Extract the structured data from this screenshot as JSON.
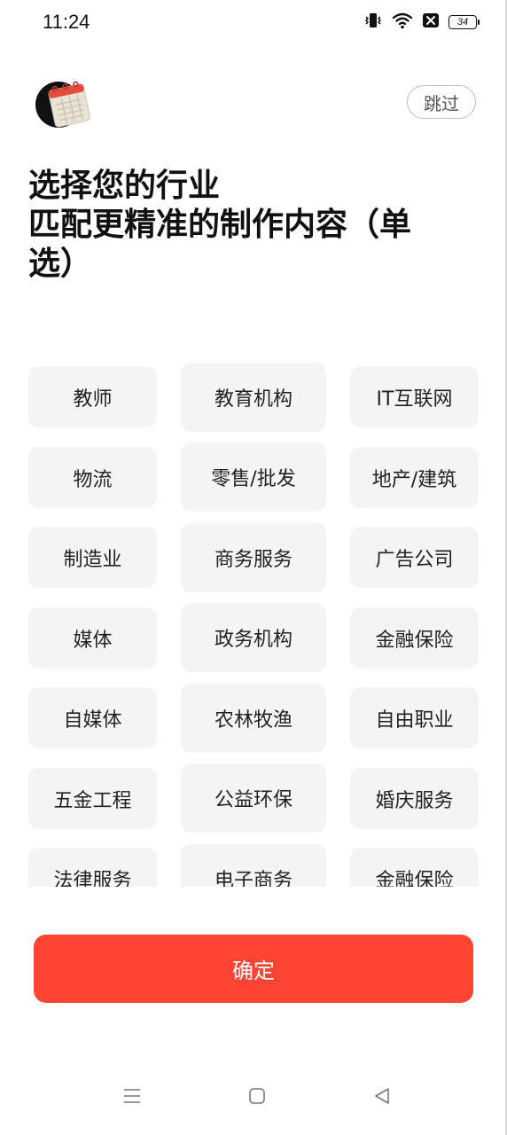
{
  "status_bar": {
    "time": "11:24",
    "battery_level": "34"
  },
  "header": {
    "skip_label": "跳过"
  },
  "title": {
    "line1": "选择您的行业",
    "line2": "匹配更精准的制作内容（单",
    "line3": "选）"
  },
  "industries": [
    "教师",
    "教育机构",
    "IT互联网",
    "物流",
    "零售/批发",
    "地产/建筑",
    "制造业",
    "商务服务",
    "广告公司",
    "媒体",
    "政务机构",
    "金融保险",
    "自媒体",
    "农林牧渔",
    "自由职业",
    "五金工程",
    "公益环保",
    "婚庆服务",
    "法律服务",
    "电子商务",
    "金融保险"
  ],
  "confirm_label": "确定",
  "colors": {
    "accent": "#ff4433",
    "chip_bg": "#f4f4f4"
  },
  "icons": {
    "logo": "calendar-notepad-icon",
    "nav": [
      "menu-icon",
      "home-square-icon",
      "back-triangle-icon"
    ]
  }
}
